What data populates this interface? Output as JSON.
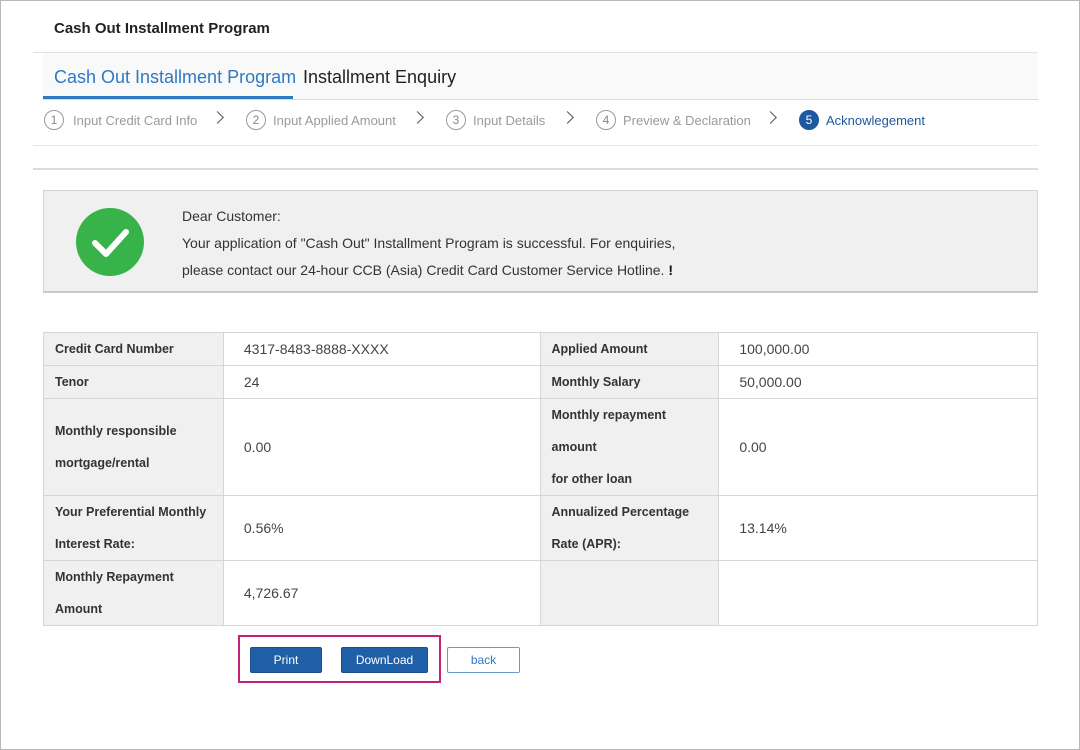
{
  "page": {
    "title": "Cash Out Installment Program"
  },
  "tabs": [
    {
      "label": "Cash Out Installment Program",
      "active": true
    },
    {
      "label": "Installment Enquiry",
      "active": false
    }
  ],
  "steps": [
    {
      "num": "1",
      "label": "Input Credit Card Info"
    },
    {
      "num": "2",
      "label": "Input Applied Amount"
    },
    {
      "num": "3",
      "label": "Input Details"
    },
    {
      "num": "4",
      "label": "Preview & Declaration"
    },
    {
      "num": "5",
      "label": "Acknowlegement"
    }
  ],
  "notice": {
    "greeting": "Dear Customer:",
    "line1": "Your application of \"Cash Out\" Installment Program is successful. For enquiries,",
    "line2": "please contact our 24-hour CCB (Asia) Credit Card Customer Service Hotline.",
    "mark": "!"
  },
  "details": {
    "card_number_label": "Credit Card Number",
    "card_number": "4317-8483-8888-XXXX",
    "applied_amount_label": "Applied Amount",
    "applied_amount": "100,000.00",
    "tenor_label": "Tenor",
    "tenor": "24",
    "monthly_salary_label": "Monthly Salary",
    "monthly_salary": "50,000.00",
    "mortgage_label_1": "Monthly responsible",
    "mortgage_label_2": "mortgage/rental",
    "mortgage": "0.00",
    "other_loan_label_1": "Monthly repayment amount",
    "other_loan_label_2": "for other loan",
    "other_loan": "0.00",
    "rate_label_1": "Your Preferential Monthly",
    "rate_label_2": "Interest Rate:",
    "rate": "0.56%",
    "apr_label_1": "Annualized Percentage",
    "apr_label_2": "Rate (APR):",
    "apr": "13.14%",
    "repayment_label_1": "Monthly Repayment",
    "repayment_label_2": "Amount",
    "repayment": "4,726.67"
  },
  "buttons": {
    "print": "Print",
    "download": "DownLoad",
    "back": "back"
  },
  "colors": {
    "accent": "#2e79c4",
    "primary_button": "#1f5fa8",
    "success": "#37b34a",
    "highlight": "#c1237b"
  }
}
